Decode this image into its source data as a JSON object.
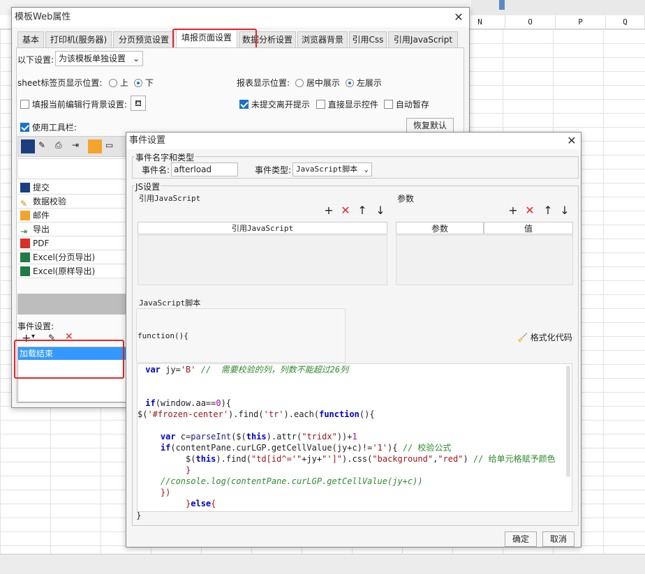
{
  "spreadsheet": {
    "columns": [
      "N",
      "O",
      "P",
      "Q"
    ]
  },
  "web_dialog": {
    "title": "模板Web属性",
    "tabs": [
      "基本",
      "打印机(服务器)",
      "分页预览设置",
      "填报页面设置",
      "数据分析设置",
      "浏览器背景",
      "引用Css",
      "引用JavaScript"
    ],
    "active_tab": "填报页面设置",
    "following_settings_label": "以下设置:",
    "following_settings_value": "为该模板单独设置",
    "sheet_tab_position_label": "sheet标签页显示位置:",
    "sheet_tab_top": "上",
    "sheet_tab_bottom": "下",
    "report_position_label": "报表显示位置:",
    "report_center": "居中展示",
    "report_left": "左展示",
    "fill_row_bg_label": "填报当前编辑行背景设置:",
    "unsubmitted_prompt": "未提交离开提示",
    "direct_show_controls": "直接显示控件",
    "auto_save": "自动暂存",
    "use_toolbar": "使用工具栏:",
    "restore_default": "恢复默认",
    "toolbar_items": [
      {
        "label": "提交",
        "icon": "save-icon"
      },
      {
        "label": "数据校验",
        "icon": "pencil-icon"
      },
      {
        "label": "邮件",
        "icon": "email-icon"
      },
      {
        "label": "导出",
        "icon": "export-icon"
      },
      {
        "label": "PDF",
        "icon": "pdf-icon"
      },
      {
        "label": "Excel(分页导出)",
        "icon": "excel-icon"
      },
      {
        "label": "Excel(原样导出)",
        "icon": "excel-icon"
      }
    ],
    "event_settings_label": "事件设置:",
    "events": [
      "加载结束"
    ]
  },
  "event_dialog": {
    "title": "事件设置",
    "name_type_group": "事件名字和类型",
    "event_name_label": "事件名:",
    "event_name_value": "afterload",
    "event_type_label": "事件类型:",
    "event_type_value": "JavaScript脚本",
    "js_group": "JS设置",
    "ref_js_label": "引用JavaScript",
    "ref_js_header": "引用JavaScript",
    "params_label": "参数",
    "params_headers": [
      "参数",
      "值"
    ],
    "script_label": "JavaScript脚本",
    "function_header": "function(){",
    "format_code": "格式化代码",
    "closing_brace": "}",
    "ok": "确定",
    "cancel": "取消"
  },
  "code_lines": {
    "l1_a": " var",
    "l1_b": " jy=",
    "l1_c": "'B'",
    "l1_d": " //  需要校验的列，列数不能超过26列",
    "l3_a": " if",
    "l3_b": "(window.aa==",
    "l3_c": "0",
    "l3_d": "){",
    "l4_a": "$(",
    "l4_b": "'#frozen-center'",
    "l4_c": ").find(",
    "l4_d": "'tr'",
    "l4_e": ").each(",
    "l4_f": "function",
    "l4_g": "(){",
    "l6_a": "    var",
    "l6_b": " c=",
    "l6_c": "parseInt",
    "l6_d": "($(",
    "l6_e": "this",
    "l6_f": ").attr(",
    "l6_g": "\"tridx\"",
    "l6_h": "))+",
    "l6_i": "1",
    "l7_a": "    if",
    "l7_b": "(contentPane.curLGP.getCellValue(jy+c)!=",
    "l7_c": "'1'",
    "l7_d": "){ ",
    "l7_e": "// 校验公式",
    "l8_a": "         $(",
    "l8_b": "this",
    "l8_c": ").find(",
    "l8_d": "\"td[id^='\"",
    "l8_e": "+jy+",
    "l8_f": "\"']\"",
    "l8_g": ").css(",
    "l8_h": "\"background\"",
    "l8_i": ",",
    "l8_j": "\"red\"",
    "l8_k": ") ",
    "l8_l": "// 给单元格赋予颜色",
    "l9": "         }",
    "l10": "    //console.log(contentPane.curLGP.getCellValue(jy+c))",
    "l11": "    })",
    "l12_a": "         }",
    "l12_b": "else",
    "l12_c": "{"
  },
  "colors": {
    "accent": "#1a73c9",
    "highlight_red": "#e3262b",
    "selected_row": "#3399ff"
  }
}
